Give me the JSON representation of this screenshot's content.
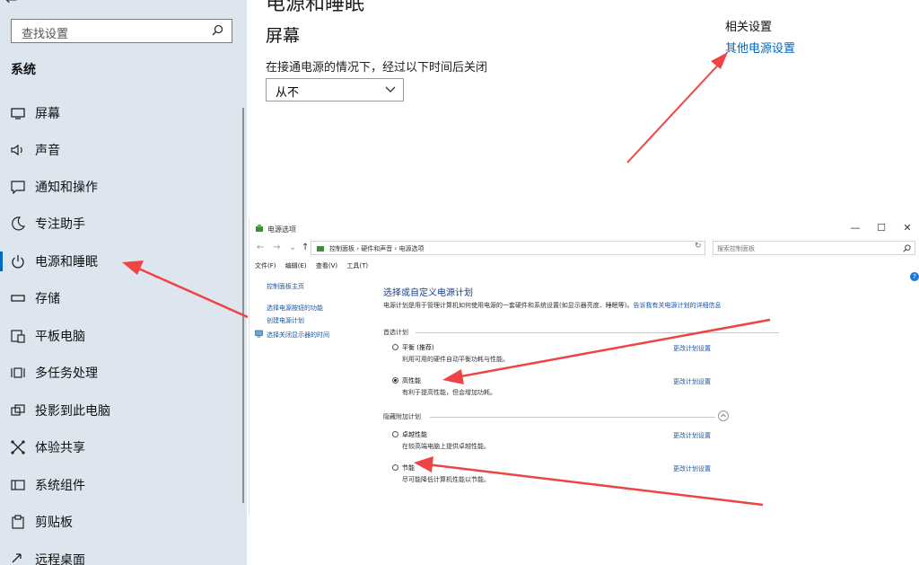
{
  "sidebar": {
    "search_placeholder": "查找设置",
    "section_title": "系统",
    "items": [
      {
        "label": "屏幕",
        "icon": "monitor-icon"
      },
      {
        "label": "声音",
        "icon": "speaker-icon"
      },
      {
        "label": "通知和操作",
        "icon": "notification-icon"
      },
      {
        "label": "专注助手",
        "icon": "moon-icon"
      },
      {
        "label": "电源和睡眠",
        "icon": "power-icon",
        "active": true
      },
      {
        "label": "存储",
        "icon": "storage-icon"
      },
      {
        "label": "平板电脑",
        "icon": "tablet-icon"
      },
      {
        "label": "多任务处理",
        "icon": "multitask-icon"
      },
      {
        "label": "投影到此电脑",
        "icon": "project-icon"
      },
      {
        "label": "体验共享",
        "icon": "share-icon"
      },
      {
        "label": "系统组件",
        "icon": "components-icon"
      },
      {
        "label": "剪贴板",
        "icon": "clipboard-icon"
      },
      {
        "label": "远程桌面",
        "icon": "remote-desktop-icon"
      }
    ]
  },
  "main": {
    "header_cut": "电源和睡眠",
    "screen_title": "屏幕",
    "screen_desc": "在接通电源的情况下，经过以下时间后关闭",
    "sleep_value": "从不",
    "related_title": "相关设置",
    "related_link": "其他电源设置"
  },
  "power_options": {
    "window_title": "电源选项",
    "breadcrumbs": "控制面板  ›  硬件和声音  ›  电源选项",
    "search_placeholder": "搜索控制面板",
    "menu": [
      "文件(F)",
      "编辑(E)",
      "查看(V)",
      "工具(T)"
    ],
    "left_links": [
      "控制面板主页",
      "选择电源按钮的功能",
      "创建电源计划",
      "选择关闭显示器的时间"
    ],
    "heading": "选择或自定义电源计划",
    "intro": "电源计划是用于管理计算机如何使用电源的一套硬件和系统设置(如显示器亮度、睡眠等)。",
    "intro_link": "告诉我有关电源计划的详细信息",
    "preferred_label": "首选计划",
    "hidden_label": "隐藏附加计划",
    "change_label": "更改计划设置",
    "plans": [
      {
        "name": "平衡 (推荐)",
        "desc": "利用可用的硬件自动平衡功耗与性能。",
        "selected": false
      },
      {
        "name": "高性能",
        "desc": "有利于提高性能，但会增加功耗。",
        "selected": true
      },
      {
        "name": "卓越性能",
        "desc": "在较高端电脑上提供卓越性能。",
        "selected": false
      },
      {
        "name": "节能",
        "desc": "尽可能降低计算机性能以节能。",
        "selected": false
      }
    ]
  },
  "colors": {
    "sidebar_bg": "#dde6ef",
    "accent": "#0067c0",
    "arrow": "#ee4444"
  }
}
